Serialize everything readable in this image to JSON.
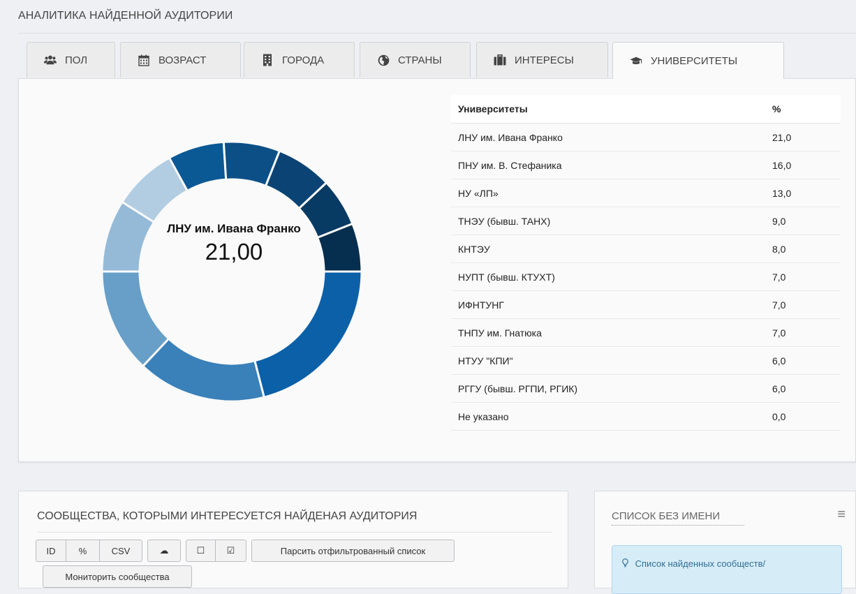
{
  "page": {
    "section_title": "АНАЛИТИКА НАЙДЕННОЙ АУДИТОРИИ"
  },
  "tabs": [
    {
      "label": "ПОЛ",
      "icon": "users-icon"
    },
    {
      "label": "ВОЗРАСТ",
      "icon": "calendar-icon"
    },
    {
      "label": "ГОРОДА",
      "icon": "building-icon"
    },
    {
      "label": "СТРАНЫ",
      "icon": "globe-icon"
    },
    {
      "label": "ИНТЕРЕСЫ",
      "icon": "briefcase-icon"
    },
    {
      "label": "УНИВЕРСИТЕТЫ",
      "icon": "graduation-cap-icon",
      "active": true
    }
  ],
  "donut": {
    "center_label": "ЛНУ им. Ивана Франко",
    "center_value": "21,00"
  },
  "chart_data": {
    "type": "pie",
    "values": [
      21,
      16,
      13,
      9,
      8,
      7,
      7,
      7,
      6,
      6,
      0
    ],
    "colors": [
      "#0b60a8",
      "#3a80b9",
      "#679fc8",
      "#95bad8",
      "#b2cde2",
      "#0a5894",
      "#0c4f87",
      "#0b4474",
      "#083b63",
      "#062e4e",
      "#03243d"
    ]
  },
  "table": {
    "headers": [
      "Университеты",
      "%"
    ],
    "rows": [
      [
        "ЛНУ им. Ивана Франко",
        "21,0"
      ],
      [
        "ПНУ им. В. Стефаника",
        "16,0"
      ],
      [
        "НУ «ЛП»",
        "13,0"
      ],
      [
        "ТНЭУ (бывш. ТАНХ)",
        "9,0"
      ],
      [
        "КНТЭУ",
        "8,0"
      ],
      [
        "НУПТ (бывш. КТУХТ)",
        "7,0"
      ],
      [
        "ИФНТУНГ",
        "7,0"
      ],
      [
        "ТНПУ им. Гнатюка",
        "7,0"
      ],
      [
        "НТУУ \"КПИ\"",
        "6,0"
      ],
      [
        "РГГУ (бывш. РГПИ, РГИК)",
        "6,0"
      ],
      [
        "Не указано",
        "0,0"
      ]
    ]
  },
  "communities": {
    "title": "СООБЩЕСТВА, КОТОРЫМИ ИНТЕРЕСУЕТСЯ НАЙДЕНАЯ АУДИТОРИЯ",
    "btn_id": "ID",
    "btn_link": "%",
    "btn_csv": "CSV",
    "btn_cloud": "☁",
    "btn_unchecked": "☐",
    "btn_checked": "☑",
    "btn_parse": "Парсить отфильтрованный список",
    "btn_monitor": "Мониторить сообщества"
  },
  "list": {
    "title": "СПИСОК БЕЗ ИМЕНИ",
    "menu": "≡",
    "info_text": "Список найденных сообществ/"
  }
}
